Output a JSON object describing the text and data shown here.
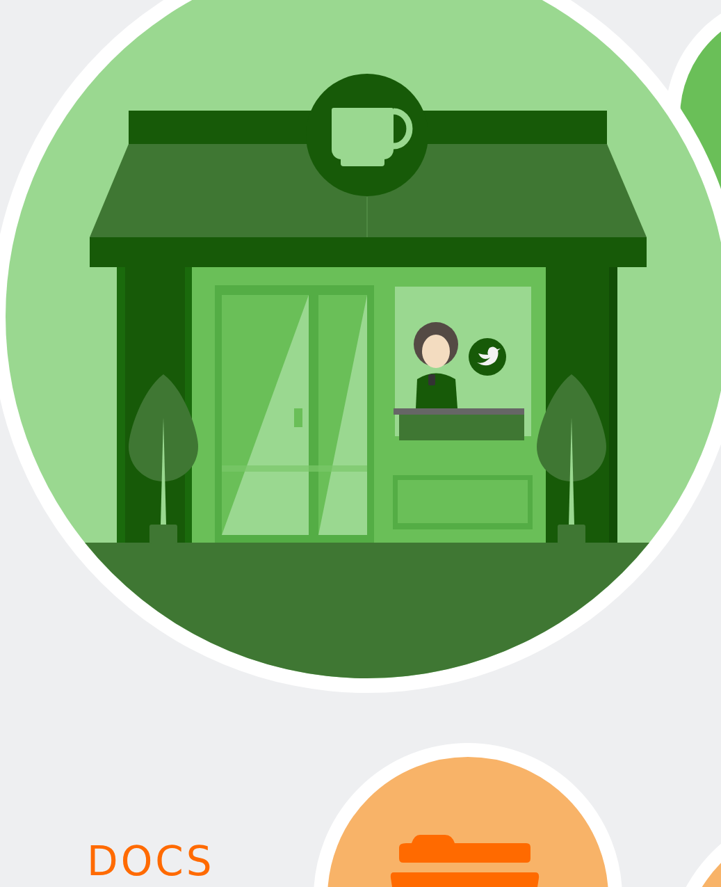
{
  "docs_heading": {
    "text": "DOCS"
  }
}
